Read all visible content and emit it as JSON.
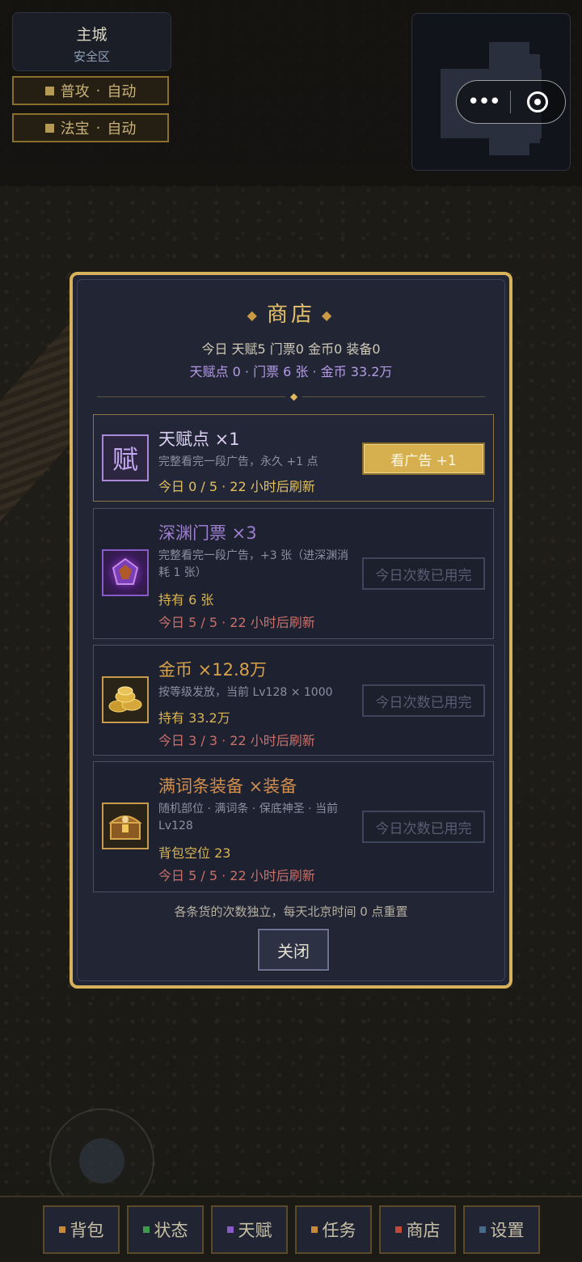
{
  "hud": {
    "zone_name": "主城",
    "zone_status": "安全区",
    "toggles": [
      {
        "label": "普攻",
        "sep": "·",
        "mode": "自动"
      },
      {
        "label": "法宝",
        "sep": "·",
        "mode": "自动"
      }
    ],
    "capsule": {
      "more_icon": "•••",
      "close_icon": "target-ring"
    }
  },
  "shop": {
    "title": "商店",
    "summary_line": "今日 天赋5 门票0 金币0 装备0",
    "balance_line": "天赋点 0 · 门票 6 张 · 金币 33.2万",
    "items": [
      {
        "icon_text": "赋",
        "name": "天赋点 ×1",
        "desc": "完整看完一段广告，永久 +1 点",
        "hold": "",
        "daily": "今日 0 / 5 · 22 小时后刷新",
        "button": "看广告 +1",
        "enabled": true,
        "name_color": "#dcd0f5",
        "daily_color": "#e3c15e"
      },
      {
        "icon_text": "",
        "name": "深渊门票 ×3",
        "desc": "完整看完一段广告，+3 张（进深渊消耗 1 张）",
        "hold": "持有 6 张",
        "daily": "今日 5 / 5 · 22 小时后刷新",
        "button": "今日次数已用完",
        "enabled": false,
        "name_color": "#9d7fcf",
        "daily_color": "#c9706a"
      },
      {
        "icon_text": "",
        "name": "金币 ×12.8万",
        "desc": "按等级发放，当前 Lv128 × 1000",
        "hold": "持有 33.2万",
        "daily": "今日 3 / 3 · 22 小时后刷新",
        "button": "今日次数已用完",
        "enabled": false,
        "name_color": "#d7a34a",
        "daily_color": "#c9706a"
      },
      {
        "icon_text": "",
        "name": "满词条装备 ×装备",
        "desc": "随机部位 · 满词条 · 保底神圣 · 当前 Lv128",
        "hold": "背包空位 23",
        "daily": "今日 5 / 5 · 22 小时后刷新",
        "button": "今日次数已用完",
        "enabled": false,
        "name_color": "#d08e4e",
        "daily_color": "#c9706a"
      }
    ],
    "footnote": "各条货的次数独立，每天北京时间 0 点重置",
    "close_label": "关闭"
  },
  "nav": [
    {
      "label": "背包",
      "color": "#c88a3a"
    },
    {
      "label": "状态",
      "color": "#3f9a4a"
    },
    {
      "label": "天赋",
      "color": "#8a5ac8"
    },
    {
      "label": "任务",
      "color": "#c88a3a"
    },
    {
      "label": "商店",
      "color": "#c04a3a"
    },
    {
      "label": "设置",
      "color": "#4a6a8a"
    }
  ]
}
